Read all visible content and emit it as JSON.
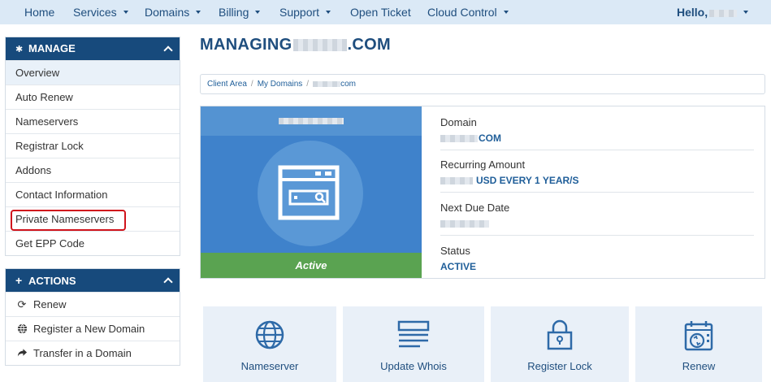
{
  "nav": {
    "items": [
      {
        "label": "Home",
        "dropdown": false
      },
      {
        "label": "Services",
        "dropdown": true
      },
      {
        "label": "Domains",
        "dropdown": true
      },
      {
        "label": "Billing",
        "dropdown": true
      },
      {
        "label": "Support",
        "dropdown": true
      },
      {
        "label": "Open Ticket",
        "dropdown": false
      },
      {
        "label": "Cloud Control",
        "dropdown": true
      }
    ],
    "greeting": "Hello,"
  },
  "manage": {
    "title": "MANAGE",
    "items": [
      "Overview",
      "Auto Renew",
      "Nameservers",
      "Registrar Lock",
      "Addons",
      "Contact Information",
      "Private Nameservers",
      "Get EPP Code"
    ]
  },
  "actions": {
    "title": "ACTIONS",
    "items": [
      {
        "label": "Renew",
        "icon": "refresh-icon"
      },
      {
        "label": "Register a New Domain",
        "icon": "globe-icon"
      },
      {
        "label": "Transfer in a Domain",
        "icon": "share-arrow-icon"
      }
    ]
  },
  "main": {
    "title_prefix": "MANAGING",
    "title_suffix": ".COM",
    "breadcrumb": [
      "Client Area",
      "My Domains",
      "com"
    ],
    "status_banner": "Active",
    "details": {
      "domain_label": "Domain",
      "domain_value": "COM",
      "recurring_label": "Recurring Amount",
      "recurring_value": "USD EVERY 1 YEAR/S",
      "due_label": "Next Due Date",
      "status_label": "Status",
      "status_value": "ACTIVE"
    },
    "tiles": [
      {
        "label": "Nameserver",
        "icon": "globe-icon"
      },
      {
        "label": "Update Whois",
        "icon": "document-lines-icon"
      },
      {
        "label": "Register Lock",
        "icon": "padlock-icon"
      },
      {
        "label": "Renew",
        "icon": "calendar-refresh-icon"
      }
    ]
  },
  "colors": {
    "nav_bg": "#dbe9f6",
    "panel_header": "#174a7c",
    "accent_blue": "#3f82cb",
    "active_green": "#5aa351",
    "highlight_red": "#d0141c"
  }
}
